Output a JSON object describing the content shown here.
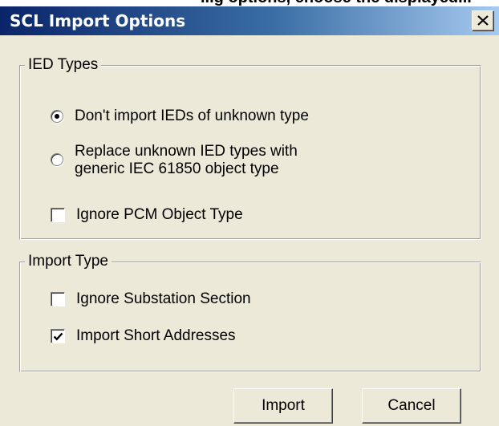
{
  "top_strip_text": "...g options, choose the displayed...",
  "window": {
    "title": "SCL Import Options"
  },
  "ied_types": {
    "legend": "IED Types",
    "option_dont_import": "Don't import IEDs of unknown type",
    "option_replace_line1": "Replace unknown IED types with",
    "option_replace_line2": "generic IEC 61850 object type",
    "ignore_pcm": "Ignore PCM Object Type",
    "selected_option": "option_dont_import",
    "ignore_pcm_checked": false
  },
  "import_type": {
    "legend": "Import Type",
    "ignore_substation": "Ignore Substation Section",
    "import_short_addresses": "Import Short Addresses",
    "ignore_substation_checked": false,
    "import_short_addresses_checked": true
  },
  "buttons": {
    "import": "Import",
    "cancel": "Cancel"
  }
}
